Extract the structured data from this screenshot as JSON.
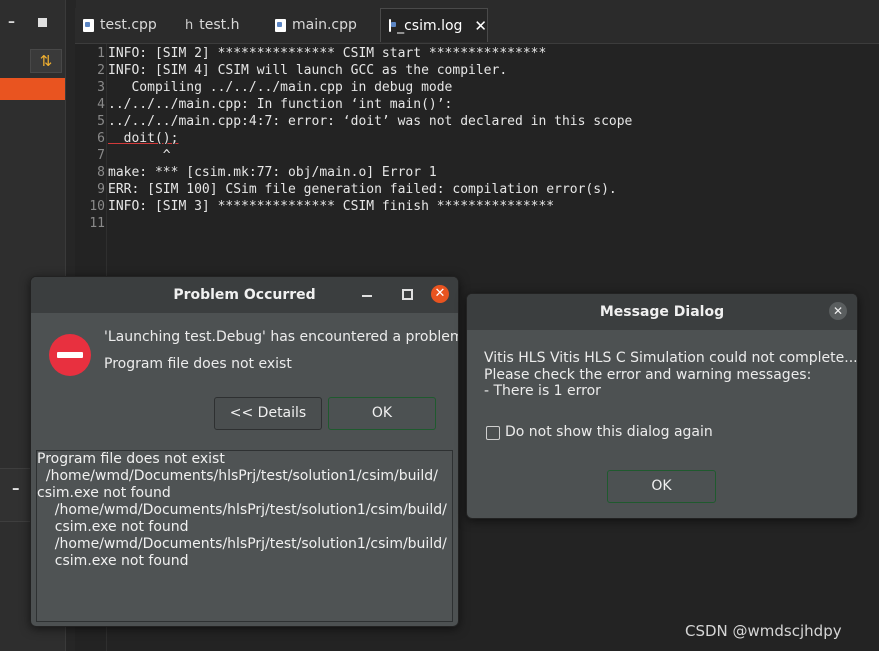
{
  "left_panel": {
    "minimize_glyph": "–",
    "lower_minimize_glyph": "–",
    "sync_glyph": "⇅"
  },
  "tabs": [
    {
      "label": "test.cpp",
      "icon": "cpp-file-icon"
    },
    {
      "label": "test.h",
      "icon": "header-file-icon"
    },
    {
      "label": "main.cpp",
      "icon": "cpp-file-icon"
    },
    {
      "label": "_csim.log",
      "icon": "text-file-icon",
      "active": true
    }
  ],
  "tab_close_glyph": "✕",
  "editor": {
    "line_numbers": [
      "1",
      "2",
      "3",
      "4",
      "5",
      "6",
      "7",
      "8",
      "9",
      "10",
      "11"
    ],
    "lines": [
      "INFO: [SIM 2] *************** CSIM start ***************",
      "INFO: [SIM 4] CSIM will launch GCC as the compiler.",
      "   Compiling ../../../main.cpp in debug mode",
      "../../../main.cpp: In function ‘int main()’:",
      "../../../main.cpp:4:7: error: ‘doit’ was not declared in this scope",
      "  doit();",
      "       ^",
      "make: *** [csim.mk:77: obj/main.o] Error 1",
      "ERR: [SIM 100] CSim file generation failed: compilation error(s).",
      "INFO: [SIM 3] *************** CSIM finish ***************",
      ""
    ]
  },
  "problem_dialog": {
    "title": "Problem Occurred",
    "minimize_glyph": "–",
    "close_glyph": "✕",
    "message": "'Launching test.Debug' has encountered a problem.",
    "submessage": "Program file does not exist",
    "details_button": "<< Details",
    "ok_button": "OK",
    "details_lines": [
      "Program file does not exist",
      "  /home/wmd/Documents/hlsPrj/test/solution1/csim/build/",
      "csim.exe not found",
      "    /home/wmd/Documents/hlsPrj/test/solution1/csim/build/",
      "    csim.exe not found",
      "    /home/wmd/Documents/hlsPrj/test/solution1/csim/build/",
      "    csim.exe not found"
    ]
  },
  "message_dialog": {
    "title": "Message Dialog",
    "close_glyph": "✕",
    "lines": [
      "Vitis HLS Vitis HLS C Simulation could not complete...",
      "Please check the error and warning messages:",
      "- There is 1 error"
    ],
    "checkbox_label": "Do not show this dialog again",
    "checkbox_checked": false,
    "ok_button": "OK"
  },
  "watermark": "CSDN @wmdscjhdpy",
  "colors": {
    "accent": "#e95420",
    "error_red": "#e8303f",
    "dialog_bg": "#4d5152",
    "editor_bg": "#232323"
  }
}
